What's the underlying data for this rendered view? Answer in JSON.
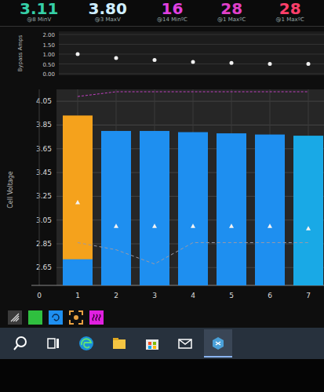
{
  "header": {
    "stats": [
      {
        "value": "3.11",
        "label": "@8 MinV",
        "color": "#36d0a8"
      },
      {
        "value": "3.80",
        "label": "@3 MaxV",
        "color": "#cfeeff"
      },
      {
        "value": "16",
        "label": "@14 MinºC",
        "color": "#e040e0"
      },
      {
        "value": "28",
        "label": "@1 MaxºC",
        "color": "#e040c8"
      },
      {
        "value": "28",
        "label": "@1 MaxºC",
        "color": "#ff3f6a"
      }
    ]
  },
  "bypass_chart": {
    "axis_title": "Bypass Amps",
    "ticks": [
      "2.00",
      "1.50",
      "1.00",
      "0.50",
      "0.00"
    ],
    "values": [
      1.0,
      0.8,
      0.7,
      0.6,
      0.55,
      0.5,
      0.5
    ]
  },
  "voltage_chart": {
    "axis_title": "Cell Voltage",
    "y_ticks": [
      "4.05",
      "3.85",
      "3.65",
      "3.45",
      "3.25",
      "3.05",
      "2.85",
      "2.65"
    ],
    "x_ticks": [
      "0",
      "1",
      "2",
      "3",
      "4",
      "5",
      "6",
      "7"
    ],
    "cells": [
      {
        "kind": "balancing",
        "voltage": 3.93,
        "lower_voltage": 2.72,
        "color": "#f5a21c"
      },
      {
        "kind": "normal",
        "voltage": 3.8,
        "lower_voltage": 0,
        "color": "#1e8ff0"
      },
      {
        "kind": "normal",
        "voltage": 3.8,
        "lower_voltage": 0,
        "color": "#1e8ff0"
      },
      {
        "kind": "normal",
        "voltage": 3.79,
        "lower_voltage": 0,
        "color": "#1e8ff0"
      },
      {
        "kind": "normal",
        "voltage": 3.78,
        "lower_voltage": 0,
        "color": "#1e8ff0"
      },
      {
        "kind": "normal",
        "voltage": 3.77,
        "lower_voltage": 0,
        "color": "#1e8ff0"
      },
      {
        "kind": "normal",
        "voltage": 3.76,
        "lower_voltage": 0,
        "color": "#19a9e6"
      }
    ],
    "markers": [
      3.2,
      3.0,
      3.0,
      3.0,
      3.0,
      3.0,
      2.98
    ],
    "min_line": [
      2.86,
      2.8,
      2.68,
      2.86,
      2.86,
      2.86,
      2.86
    ],
    "max_line": [
      4.09,
      4.13,
      4.13,
      4.13,
      4.13,
      4.13,
      4.13
    ]
  },
  "toolbar": {
    "buttons": [
      {
        "kind": "signal",
        "color": "#3a3a3a"
      },
      {
        "kind": "plain",
        "color": "#2fbf3f"
      },
      {
        "kind": "cycle",
        "color": "#1e8ff0"
      },
      {
        "kind": "dashed",
        "color": "#e8a040"
      },
      {
        "kind": "wave",
        "color": "#e020e0"
      }
    ]
  },
  "taskbar": {
    "items": [
      {
        "kind": "search",
        "selected": false
      },
      {
        "kind": "task-view",
        "selected": false
      },
      {
        "kind": "edge",
        "selected": false
      },
      {
        "kind": "explorer",
        "selected": false
      },
      {
        "kind": "store",
        "selected": false
      },
      {
        "kind": "mail",
        "selected": false
      },
      {
        "kind": "bms-app",
        "selected": true
      }
    ]
  }
}
